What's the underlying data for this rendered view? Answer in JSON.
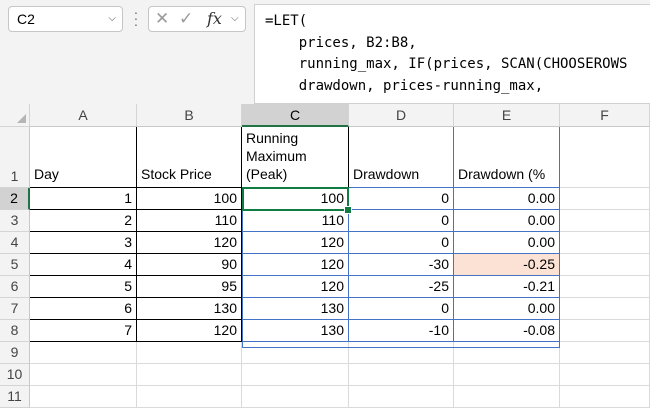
{
  "name_box": {
    "value": "C2"
  },
  "formula_bar": {
    "lines": [
      "=LET(",
      "    prices, B2:B8,",
      "    running_max, IF(prices, SCAN(CHOOSEROWS",
      "    drawdown, prices-running_max,"
    ]
  },
  "colors": {
    "active_border": "#107c41",
    "spill_border": "#4472c4",
    "highlight_fill": "#fbe2d5",
    "header_bg": "#f3f3f3",
    "selected_header_bg": "#d2d2d2"
  },
  "sheet": {
    "columns": [
      "A",
      "B",
      "C",
      "D",
      "E",
      "F"
    ],
    "selected_column": "C",
    "rows": [
      "1",
      "2",
      "3",
      "4",
      "5",
      "6",
      "7",
      "8",
      "9",
      "10",
      "11"
    ],
    "selected_row": "2",
    "headers": {
      "a": "Day",
      "b": "Stock Price",
      "c": "Running Maximum (Peak)",
      "d": "Drawdown",
      "e": "Drawdown (%"
    },
    "data": [
      {
        "day": "1",
        "price": "100",
        "peak": "100",
        "drawdown": "0",
        "pct": "0.00"
      },
      {
        "day": "2",
        "price": "110",
        "peak": "110",
        "drawdown": "0",
        "pct": "0.00"
      },
      {
        "day": "3",
        "price": "120",
        "peak": "120",
        "drawdown": "0",
        "pct": "0.00"
      },
      {
        "day": "4",
        "price": "90",
        "peak": "120",
        "drawdown": "-30",
        "pct": "-0.25"
      },
      {
        "day": "5",
        "price": "95",
        "peak": "120",
        "drawdown": "-25",
        "pct": "-0.21"
      },
      {
        "day": "6",
        "price": "130",
        "peak": "130",
        "drawdown": "0",
        "pct": "0.00"
      },
      {
        "day": "7",
        "price": "120",
        "peak": "130",
        "drawdown": "-10",
        "pct": "-0.08"
      }
    ],
    "highlighted_row": 4
  }
}
